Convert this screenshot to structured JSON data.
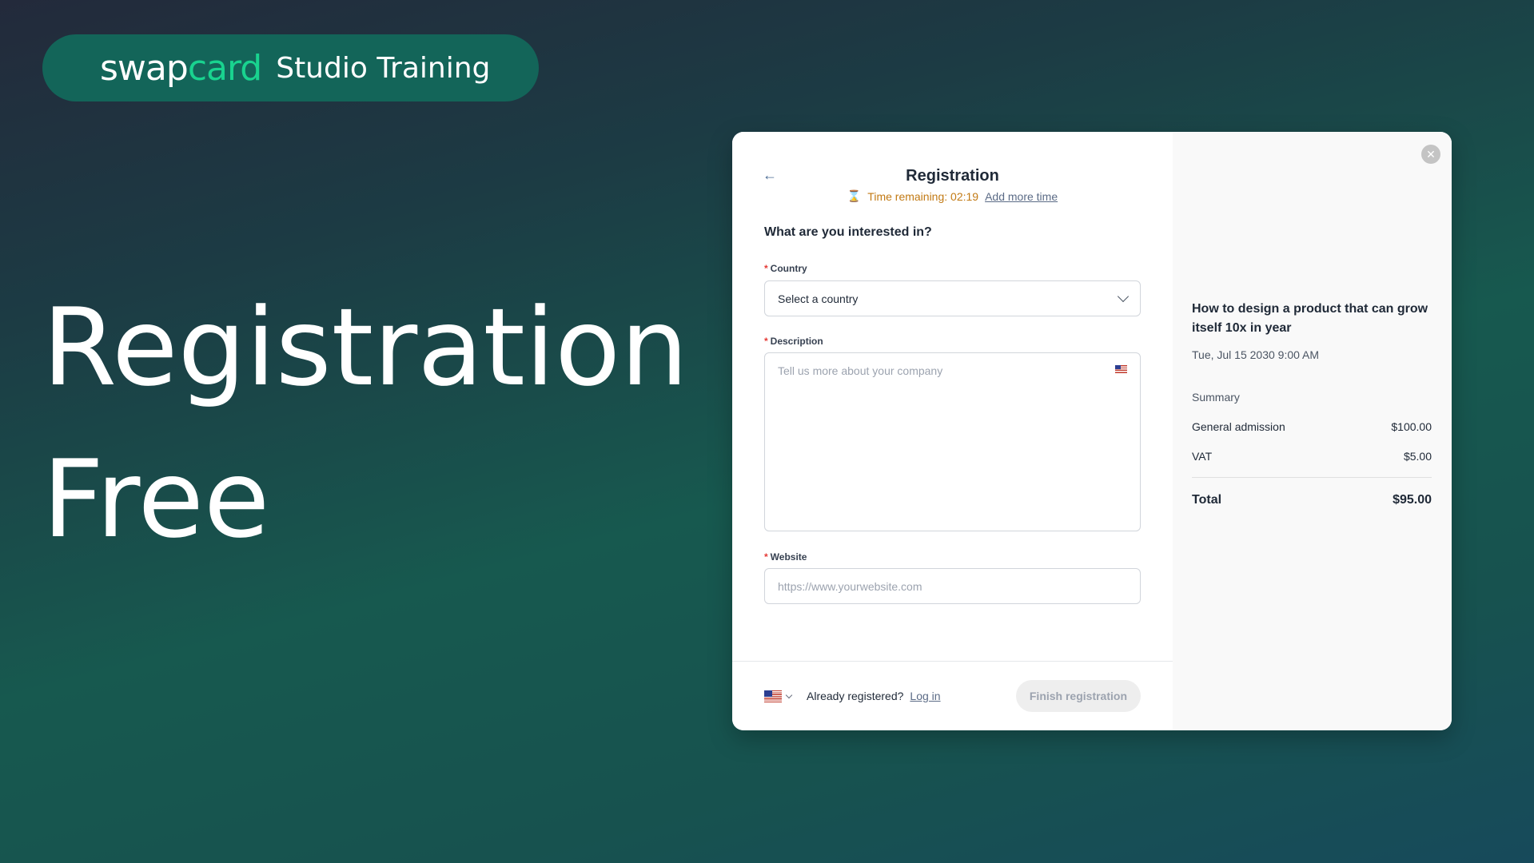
{
  "brand": {
    "logo_main": "swap",
    "logo_accent": "card",
    "title": "Studio Training"
  },
  "hero": {
    "line1": "Registration",
    "line2": "Free"
  },
  "form": {
    "back_icon": "arrow-left-icon",
    "title": "Registration",
    "timer_icon": "hourglass-icon",
    "timer_text": "Time remaining: 02:19",
    "add_time_link": "Add more time",
    "question": "What are you interested in?",
    "required_mark": "*",
    "country": {
      "label": "Country",
      "value": "Select a country"
    },
    "description": {
      "label": "Description",
      "placeholder": "Tell us more about your company"
    },
    "website": {
      "label": "Website",
      "placeholder": "https://www.yourwebsite.com"
    }
  },
  "footer": {
    "locale_flag": "us-flag-icon",
    "already_text": "Already registered?",
    "login_link": "Log in",
    "finish_button": "Finish registration"
  },
  "summary": {
    "close_icon": "close-icon",
    "event_title": "How to design a product that can grow itself 10x in year",
    "event_date": "Tue, Jul 15 2030 9:00 AM",
    "heading": "Summary",
    "items": [
      {
        "label": "General admission",
        "amount": "$100.00"
      },
      {
        "label": "VAT",
        "amount": "$5.00"
      }
    ],
    "total_label": "Total",
    "total_amount": "$95.00"
  },
  "colors": {
    "brand_accent": "#19d38f",
    "timer": "#c27a14",
    "required": "#e53935"
  }
}
